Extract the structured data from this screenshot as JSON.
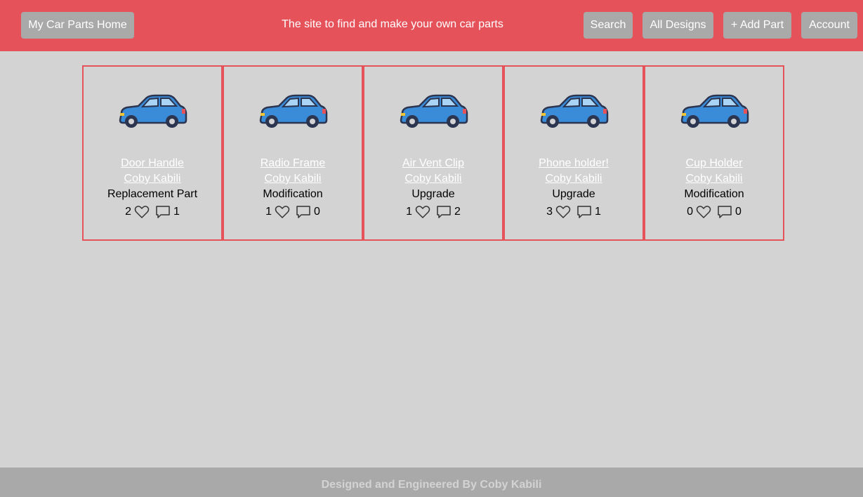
{
  "nav": {
    "home_label": "My Car Parts Home",
    "tagline": "The site to find and make your own car parts",
    "search_label": "Search",
    "all_designs_label": "All Designs",
    "add_part_label": "+ Add Part",
    "account_label": "Account"
  },
  "colors": {
    "brand": "#e5525a",
    "button": "#a9a9a9",
    "background": "#d3d3d3",
    "car_body": "#3a8bd8"
  },
  "parts": [
    {
      "title": "Door Handle",
      "author": "Coby Kabili",
      "category": "Replacement Part",
      "likes": "2",
      "comments": "1",
      "icon": "car-icon"
    },
    {
      "title": "Radio Frame",
      "author": "Coby Kabili",
      "category": "Modification",
      "likes": "1",
      "comments": "0",
      "icon": "car-icon"
    },
    {
      "title": "Air Vent Clip",
      "author": "Coby Kabili",
      "category": "Upgrade",
      "likes": "1",
      "comments": "2",
      "icon": "car-icon"
    },
    {
      "title": "Phone holder!",
      "author": "Coby Kabili",
      "category": "Upgrade",
      "likes": "3",
      "comments": "1",
      "icon": "car-icon"
    },
    {
      "title": "Cup Holder",
      "author": "Coby Kabili",
      "category": "Modification",
      "likes": "0",
      "comments": "0",
      "icon": "car-icon"
    }
  ],
  "footer": {
    "text": "Designed and Engineered By Coby Kabili"
  }
}
